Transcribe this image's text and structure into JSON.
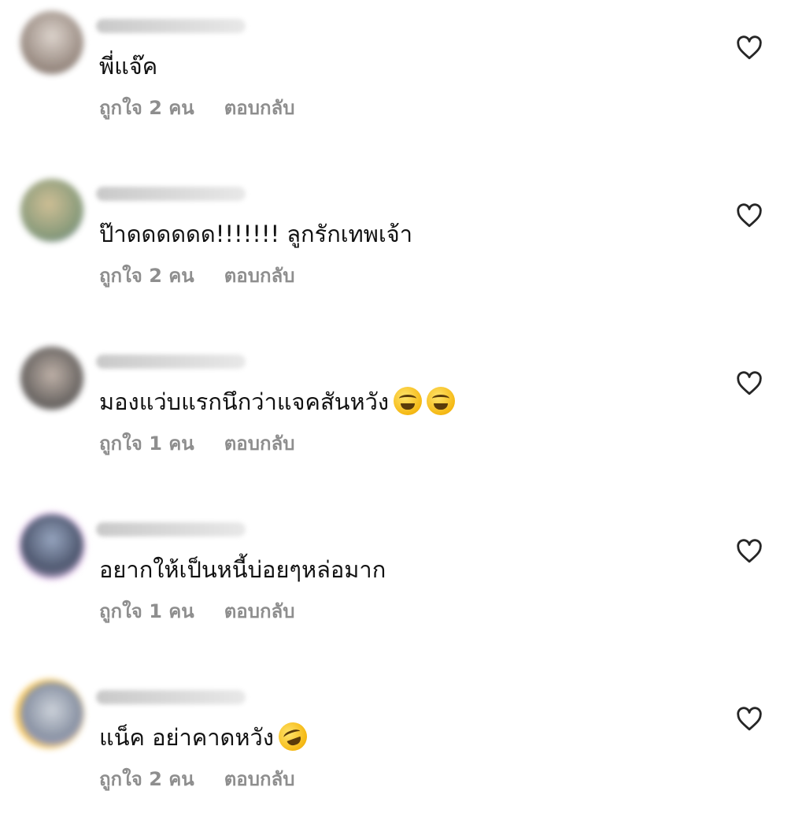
{
  "comments": [
    {
      "avatar_color": "#b9ada4",
      "text": "พี่แจ๊ค",
      "likes": "ถูกใจ 2 คน",
      "reply": "ตอบกลับ",
      "emojis": []
    },
    {
      "avatar_color": "#8aa08a",
      "text": "ป๊าดดดดดด!!!!!!! ลูกรักเทพเจ้า",
      "likes": "ถูกใจ 2 คน",
      "reply": "ตอบกลับ",
      "emojis": []
    },
    {
      "avatar_color": "#7c7f86",
      "text": "มองแว่บแรกนึกว่าแจคสันหวัง",
      "likes": "ถูกใจ 1 คน",
      "reply": "ตอบกลับ",
      "emojis": [
        "grinning-squinting",
        "grinning-squinting"
      ]
    },
    {
      "avatar_color": "#9aa6c0",
      "text": "อยากให้เป็นหนี้บ่อยๆหล่อมาก",
      "likes": "ถูกใจ 1 คน",
      "reply": "ตอบกลับ",
      "emojis": []
    },
    {
      "avatar_color": "#a4b0c4",
      "text": "แน็ค อย่าคาดหวัง",
      "likes": "ถูกใจ 2 คน",
      "reply": "ตอบกลับ",
      "emojis": [
        "rolling-laughing"
      ]
    }
  ],
  "colors": {
    "meta_text": "#8e8e8e",
    "heart_stroke": "#262626",
    "ring": "#f6c24d"
  }
}
